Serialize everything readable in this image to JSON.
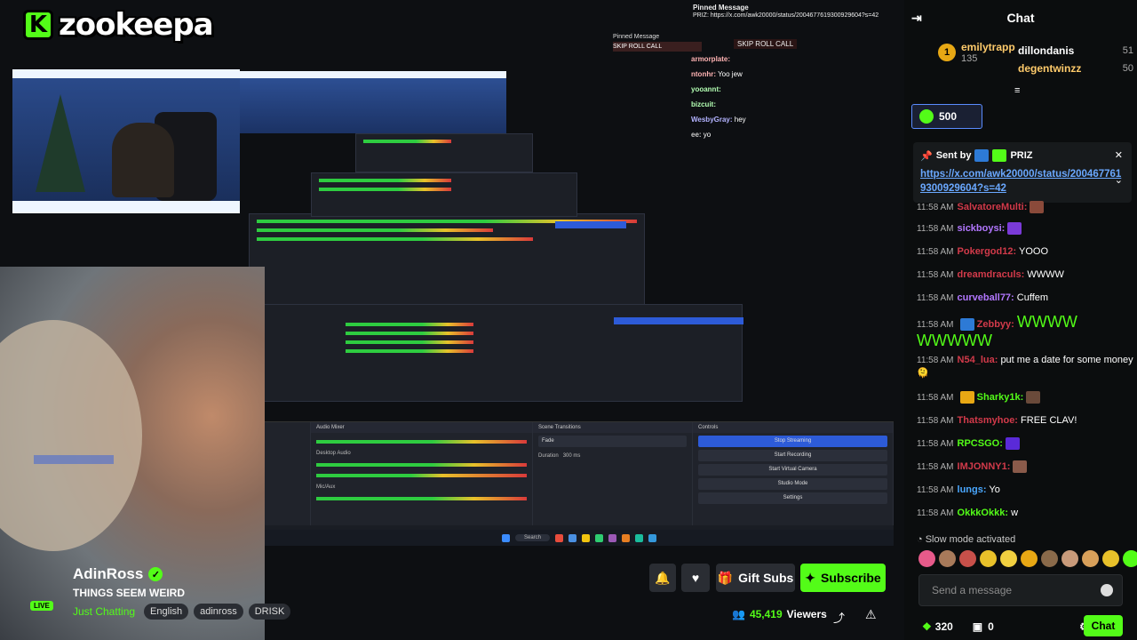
{
  "brand": {
    "name": "zookeepa",
    "logo_letter": "K",
    "accent": "#53fc18"
  },
  "stream_overlay": {
    "pinned_label": "Pinned Message",
    "pinned_text": "PRIZ: https://x.com/awk20000/status/2004677619300929604?s=42",
    "mini_chat": [
      {
        "user": "armorplate:",
        "text": ""
      },
      {
        "user": "ntonhr:",
        "text": "Yoo jew"
      },
      {
        "user": "yooannt:",
        "text": ""
      },
      {
        "user": "bizcuit:",
        "text": ""
      },
      {
        "user": "WesbyGray:",
        "text": "hey"
      },
      {
        "user": "ee:",
        "text": "yo"
      }
    ],
    "skip_roll_call": "SKIP ROLL CALL",
    "obs_labels": {
      "audio_mixer": "Audio Mixer",
      "scene_transitions": "Scene Transitions",
      "controls": "Controls",
      "fade": "Fade",
      "duration": "Duration",
      "duration_value": "300 ms",
      "desktop_audio": "Desktop Audio",
      "mic_aux": "Mic/Aux",
      "stop_streaming": "Stop Streaming",
      "start_recording": "Start Recording",
      "start_virtual_camera": "Start Virtual Camera",
      "studio_mode": "Studio Mode",
      "settings": "Settings",
      "search": "Search"
    }
  },
  "streamer": {
    "name": "AdinRoss",
    "title": "THINGS SEEM WEIRD",
    "category": "Just Chatting",
    "tags": [
      "English",
      "adinross",
      "DRISK"
    ],
    "live_label": "LIVE"
  },
  "controls": {
    "gift_label": "Gift Subs",
    "subscribe_label": "Subscribe",
    "viewers_count": "45,419",
    "viewers_label": "Viewers"
  },
  "chat": {
    "header": "Chat",
    "leaderboard": {
      "first": {
        "rank": "1",
        "name": "emilytrapp",
        "points": "135"
      },
      "others": [
        {
          "name": "dillondanis",
          "points": "51"
        },
        {
          "name": "degentwinzz",
          "points": "50"
        }
      ]
    },
    "points_pill": "500",
    "pinned": {
      "sent_by": "Sent by",
      "author": "PRIZ",
      "link": "https://x.com/awk20000/status/2004677619300929604?s=42"
    },
    "messages": [
      {
        "time": "11:58 AM",
        "user": "SalvatoreMulti:",
        "color": "#d23a4a",
        "text": ""
      },
      {
        "time": "11:58 AM",
        "user": "sickboysi:",
        "color": "#b377ff",
        "text": ""
      },
      {
        "time": "11:58 AM",
        "user": "Pokergod12:",
        "color": "#d23a4a",
        "text": "YOOO"
      },
      {
        "time": "11:58 AM",
        "user": "dreamdraculs:",
        "color": "#d23a4a",
        "text": "WWWW"
      },
      {
        "time": "11:58 AM",
        "user": "curveball77:",
        "color": "#b377ff",
        "text": "Cuffem"
      },
      {
        "time": "11:58 AM",
        "user": "Zebbyy:",
        "color": "#d23a4a",
        "text": "WWWW WWWWW"
      },
      {
        "time": "11:58 AM",
        "user": "N54_lua:",
        "color": "#d23a4a",
        "text": "put me a date for some money 🫠"
      },
      {
        "time": "11:58 AM",
        "user": "Sharky1k:",
        "color": "#53fc18",
        "text": ""
      },
      {
        "time": "11:58 AM",
        "user": "Thatsmyhoe:",
        "color": "#d23a4a",
        "text": "FREE CLAV!"
      },
      {
        "time": "11:58 AM",
        "user": "RPCSGO:",
        "color": "#53fc18",
        "text": ""
      },
      {
        "time": "11:58 AM",
        "user": "IMJONNY1:",
        "color": "#d23a4a",
        "text": ""
      },
      {
        "time": "11:58 AM",
        "user": "lungs:",
        "color": "#4aa8ff",
        "text": "Yo"
      },
      {
        "time": "11:58 AM",
        "user": "OkkkOkkk:",
        "color": "#53fc18",
        "text": "w"
      }
    ],
    "slow_mode": "Slow mode activated",
    "input_placeholder": "Send a message",
    "user_points": "320",
    "gift_count": "0",
    "send_label": "Chat"
  }
}
